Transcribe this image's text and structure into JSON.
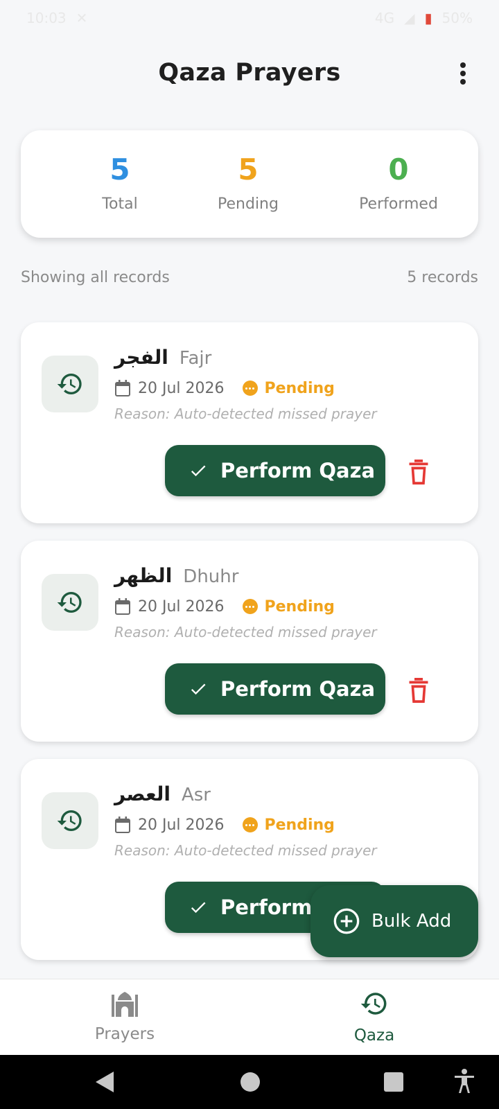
{
  "status_bar": {
    "time": "10:03",
    "network": "4G",
    "battery": "50%"
  },
  "app_bar": {
    "title": "Qaza Prayers"
  },
  "summary": {
    "total": {
      "value": "5",
      "label": "Total"
    },
    "pending": {
      "value": "5",
      "label": "Pending"
    },
    "performed": {
      "value": "0",
      "label": "Performed"
    }
  },
  "list_header": {
    "filter_text": "Showing all records",
    "count_text": "5 records"
  },
  "records": [
    {
      "arabic": "الفجر",
      "name": "Fajr",
      "date": "20 Jul 2026",
      "status": "Pending",
      "reason": "Reason: Auto-detected missed prayer",
      "action": "Perform Qaza"
    },
    {
      "arabic": "الظهر",
      "name": "Dhuhr",
      "date": "20 Jul 2026",
      "status": "Pending",
      "reason": "Reason: Auto-detected missed prayer",
      "action": "Perform Qaza"
    },
    {
      "arabic": "العصر",
      "name": "Asr",
      "date": "20 Jul 2026",
      "status": "Pending",
      "reason": "Reason: Auto-detected missed prayer",
      "action": "Perform"
    }
  ],
  "fab": {
    "label": "Bulk Add",
    "icon": "plus-circle-icon"
  },
  "bottom_nav": {
    "items": [
      {
        "label": "Prayers",
        "icon": "mosque-icon",
        "active": false
      },
      {
        "label": "Qaza",
        "icon": "history-icon",
        "active": true
      }
    ]
  },
  "colors": {
    "primary": "#1e5a3e",
    "total": "#2f8fe0",
    "pending": "#f0a31c",
    "performed": "#4caf50",
    "delete": "#e53935"
  }
}
